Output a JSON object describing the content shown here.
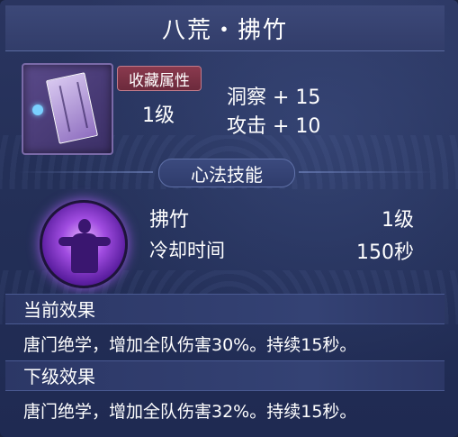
{
  "title": "八荒・拂竹",
  "item": {
    "icon": "book-scroll-icon",
    "badge_label": "收藏属性",
    "level": "1级",
    "attributes": [
      "洞察 + 15",
      "攻击 + 10"
    ]
  },
  "skill_section": {
    "header": "心法技能",
    "icon": "meditating-figure-icon",
    "name": "拂竹",
    "level": "1级",
    "cooldown_label": "冷却时间",
    "cooldown_value": "150秒"
  },
  "current_effect": {
    "header": "当前效果",
    "text": "唐门绝学，增加全队伤害30%。持续15秒。"
  },
  "next_effect": {
    "header": "下级效果",
    "text": "唐门绝学，增加全队伤害32%。持续15秒。"
  },
  "colors": {
    "background": "#243058",
    "badge": "#7a3446",
    "skill_glow": "#a04ce0"
  }
}
